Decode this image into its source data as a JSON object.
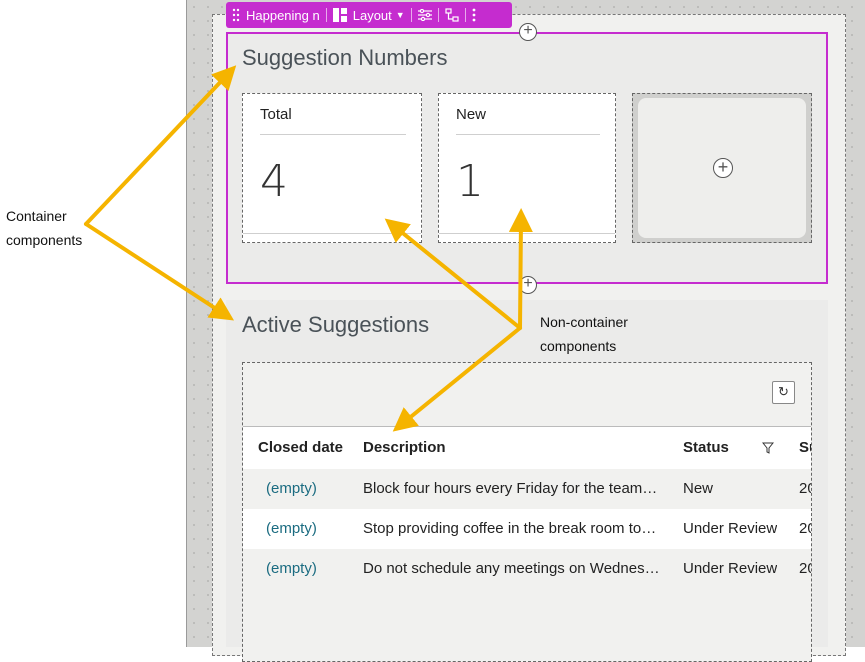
{
  "toolbar": {
    "component_name": "Happening n",
    "layout_label": "Layout",
    "items": [
      "drag-handle-icon",
      "layout-icon",
      "settings-sliders-icon",
      "hierarchy-icon",
      "more-vertical-icon"
    ]
  },
  "suggestion_numbers": {
    "title": "Suggestion Numbers",
    "cards": [
      {
        "label": "Total",
        "value": "4"
      },
      {
        "label": "New",
        "value": "1"
      }
    ],
    "add_symbol": "+"
  },
  "active_suggestions": {
    "title": "Active Suggestions",
    "refresh_symbol": "↻",
    "columns": [
      "Closed date",
      "Description",
      "Status",
      "Su"
    ],
    "rows": [
      {
        "closed_date": "(empty)",
        "description": "Block four hours every Friday for the team…",
        "status": "New",
        "su": "20"
      },
      {
        "closed_date": "(empty)",
        "description": "Stop providing coffee in the break room to…",
        "status": "Under Review",
        "su": "20"
      },
      {
        "closed_date": "(empty)",
        "description": "Do not schedule any meetings on Wednes…",
        "status": "Under Review",
        "su": "20"
      }
    ]
  },
  "annotations": {
    "container": "Container components",
    "container_line1": "Container",
    "container_line2": "components",
    "non_container_line1": "Non-container",
    "non_container_line2": "components"
  },
  "colors": {
    "selection": "#c52ccf",
    "arrow": "#f5b400",
    "link": "#1a6b80"
  }
}
